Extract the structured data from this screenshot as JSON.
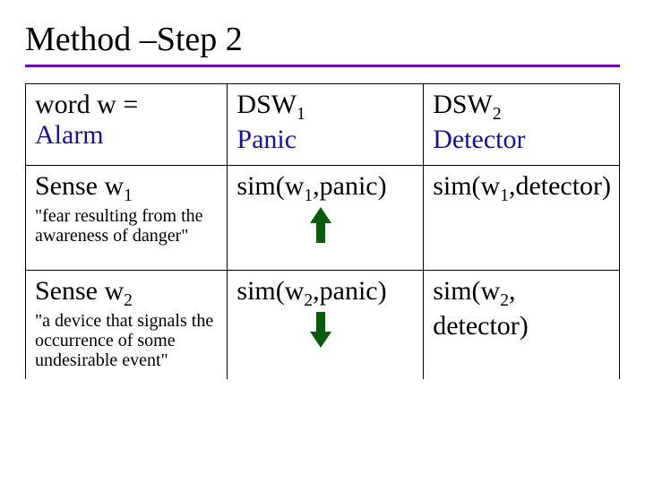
{
  "title": "Method –Step 2",
  "table": {
    "r0c0_line1": "word w =",
    "r0c0_line2": "Alarm",
    "r0c1_prefix": "DSW",
    "r0c1_sub": "1",
    "r0c1_line2": "Panic",
    "r0c2_prefix": "DSW",
    "r0c2_sub": "2",
    "r0c2_line2": "Detector",
    "r1c0_prefix": "Sense w",
    "r1c0_sub": "1",
    "r1c0_suffix": " ",
    "r1c0_small": "\"fear resulting from the awareness of danger\"",
    "r1c1_a": "sim(w",
    "r1c1_sub": "1",
    "r1c1_b": ",panic)",
    "r1c2_a": "sim(w",
    "r1c2_sub": "1",
    "r1c2_b": ",detector)",
    "r2c0_prefix": "Sense w",
    "r2c0_sub": "2",
    "r2c0_suffix": " ",
    "r2c0_small": "\"a device that signals the occurrence of some undesirable event\"",
    "r2c1_a": "sim(w",
    "r2c1_sub": "2",
    "r2c1_b": ",panic)",
    "r2c2_a": "sim(w",
    "r2c2_sub": "2",
    "r2c2_b": ", detector)"
  },
  "colors": {
    "rule": "#6a0dad",
    "accent": "#15158a",
    "arrow": "#0a5a0a"
  }
}
